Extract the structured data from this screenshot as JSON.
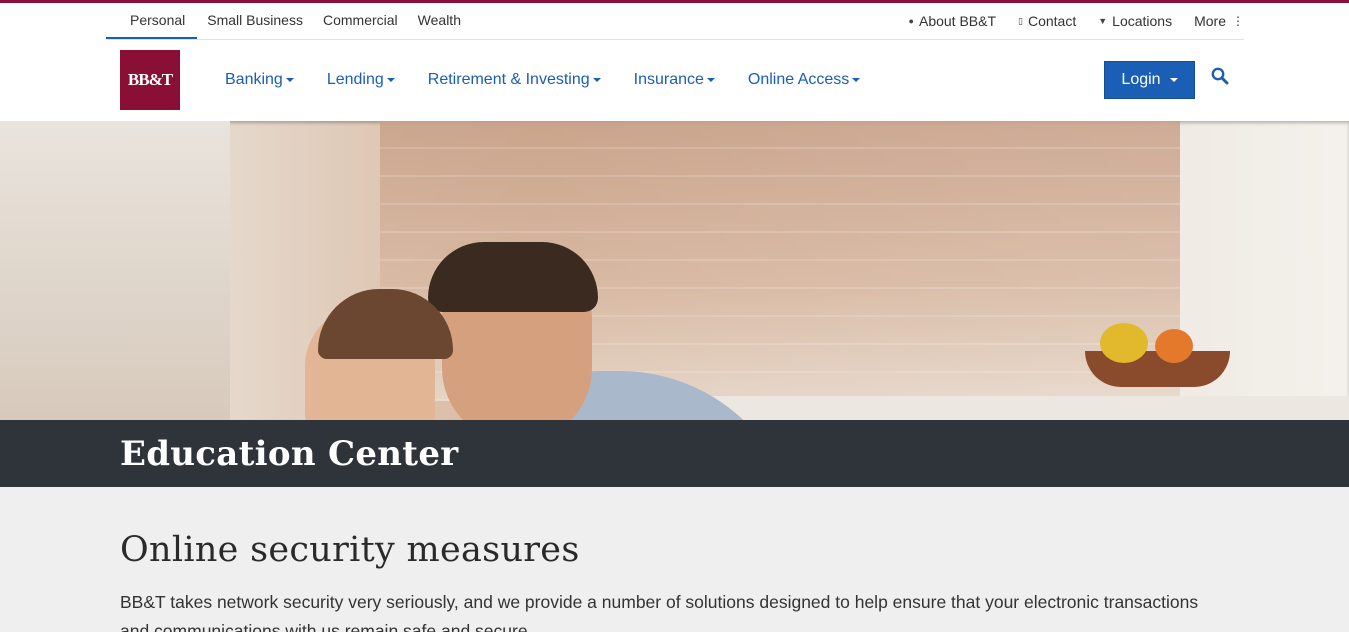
{
  "utility": {
    "segments": [
      "Personal",
      "Small Business",
      "Commercial",
      "Wealth"
    ],
    "links": {
      "about": "About BB&T",
      "contact": "Contact",
      "locations": "Locations",
      "more": "More"
    }
  },
  "brand": {
    "logo_text": "BB&T",
    "color": "#8a0f36"
  },
  "nav": {
    "items": [
      "Banking",
      "Lending",
      "Retirement & Investing",
      "Insurance",
      "Online Access"
    ],
    "login": "Login",
    "accent": "#1a5eb5"
  },
  "section": {
    "title": "Education Center"
  },
  "article": {
    "heading": "Online security measures",
    "body": "BB&T takes network security very seriously, and we provide a number of solutions designed to help ensure that your electronic transactions and communications with us remain safe and secure."
  }
}
